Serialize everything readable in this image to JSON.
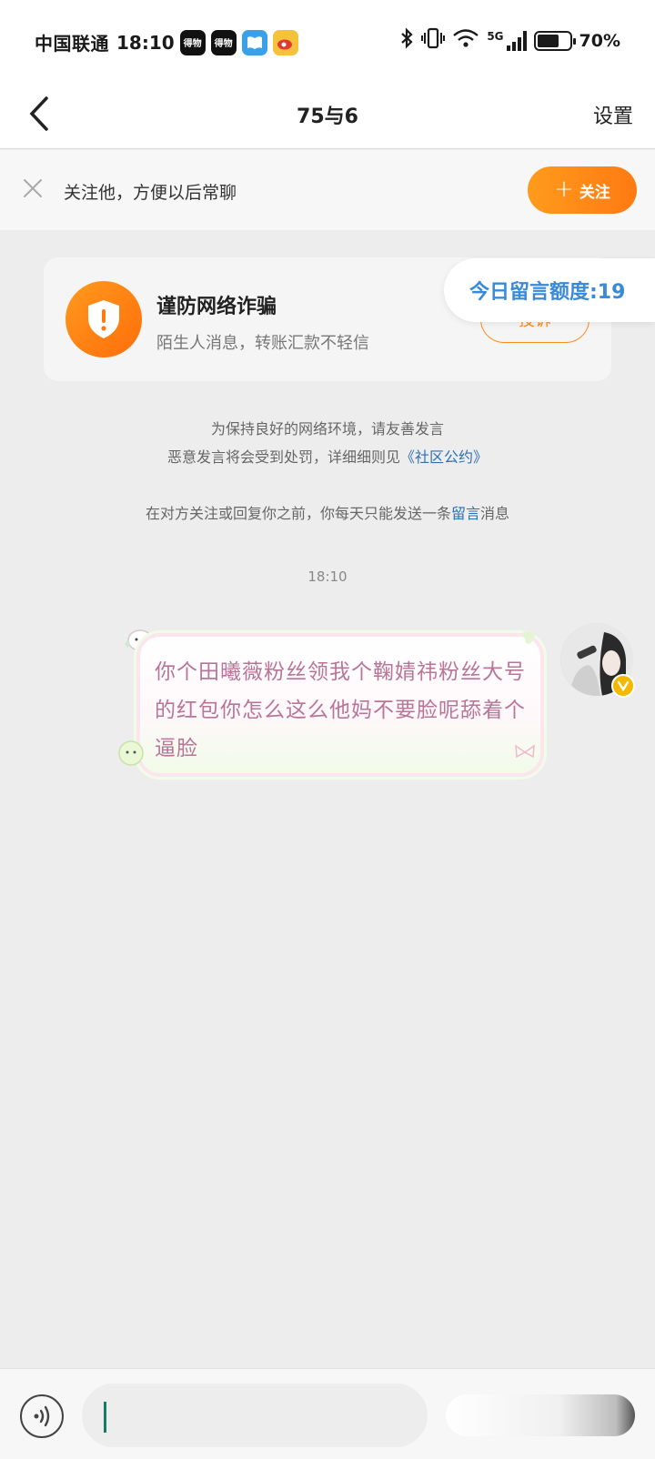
{
  "status_bar": {
    "carrier": "中国联通",
    "time": "18:10",
    "apps": [
      {
        "name": "dewu-app-icon",
        "label": "得物"
      },
      {
        "name": "dewu-app-icon-2",
        "label": "得物"
      },
      {
        "name": "reader-app-icon",
        "label": ""
      },
      {
        "name": "weibo-app-icon",
        "label": ""
      }
    ],
    "network": "5G",
    "battery_percent": "70%",
    "battery_level": 0.7
  },
  "nav": {
    "title": "75与6",
    "settings_label": "设置"
  },
  "follow_banner": {
    "text": "关注他，方便以后常聊",
    "button_label": "关注"
  },
  "fraud_card": {
    "title": "谨防网络诈骗",
    "subtitle": "陌生人消息，转账汇款不轻信",
    "report_label": "投诉"
  },
  "quota": {
    "label": "今日留言额度:19"
  },
  "notices": {
    "line1": "为保持良好的网络环境，请友善发言",
    "line2_prefix": "恶意发言将会受到处罚，详细细则见",
    "line2_link": "《社区公约》",
    "line3_prefix": "在对方关注或回复你之前，你每天只能发送一条",
    "line3_link": "留言",
    "line3_suffix": "消息"
  },
  "chat": {
    "timestamp": "18:10",
    "messages": [
      {
        "sender": "me",
        "text": "你个田曦薇粉丝领我个鞠婧祎粉丝大号的红包你怎么这么他妈不要脸呢舔着个逼脸"
      }
    ]
  },
  "input": {
    "value": "",
    "placeholder": ""
  },
  "colors": {
    "accent_orange": "#ff8c1a",
    "link_blue": "#2f6fb5",
    "quota_blue": "#3a8ad8",
    "bubble_text": "#b87598"
  }
}
